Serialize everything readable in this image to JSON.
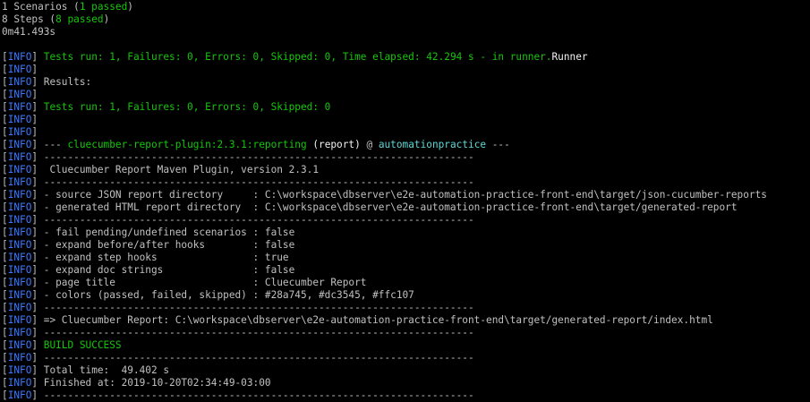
{
  "colors": {
    "background": "#000000",
    "text": "#c0c0c0",
    "success_green": "#16c60c",
    "info_blue": "#3b78ff",
    "artifact_cyan": "#61d6d6",
    "bright_white": "#f2f2f2"
  },
  "lines": [
    [
      {
        "t": "1 Scenarios (",
        "c": "w"
      },
      {
        "t": "1 passed",
        "c": "g"
      },
      {
        "t": ")",
        "c": "w"
      }
    ],
    [
      {
        "t": "8 Steps (",
        "c": "w"
      },
      {
        "t": "8 passed",
        "c": "g"
      },
      {
        "t": ")",
        "c": "w"
      }
    ],
    [
      {
        "t": "0m41.493s",
        "c": "w"
      }
    ],
    [],
    [
      {
        "t": "[",
        "c": "w"
      },
      {
        "t": "INFO",
        "c": "b"
      },
      {
        "t": "] ",
        "c": "w"
      },
      {
        "t": "Tests run: 1, Failures: 0, Errors: 0, Skipped: 0, Time elapsed: 42.294 s - in runner.",
        "c": "g"
      },
      {
        "t": "Runner",
        "c": "bw"
      }
    ],
    [
      {
        "t": "[",
        "c": "w"
      },
      {
        "t": "INFO",
        "c": "b"
      },
      {
        "t": "] ",
        "c": "w"
      }
    ],
    [
      {
        "t": "[",
        "c": "w"
      },
      {
        "t": "INFO",
        "c": "b"
      },
      {
        "t": "] Results:",
        "c": "w"
      }
    ],
    [
      {
        "t": "[",
        "c": "w"
      },
      {
        "t": "INFO",
        "c": "b"
      },
      {
        "t": "] ",
        "c": "w"
      }
    ],
    [
      {
        "t": "[",
        "c": "w"
      },
      {
        "t": "INFO",
        "c": "b"
      },
      {
        "t": "] ",
        "c": "w"
      },
      {
        "t": "Tests run: 1, Failures: 0, Errors: 0, Skipped: 0",
        "c": "g"
      }
    ],
    [
      {
        "t": "[",
        "c": "w"
      },
      {
        "t": "INFO",
        "c": "b"
      },
      {
        "t": "] ",
        "c": "w"
      }
    ],
    [
      {
        "t": "[",
        "c": "w"
      },
      {
        "t": "INFO",
        "c": "b"
      },
      {
        "t": "] ",
        "c": "w"
      }
    ],
    [
      {
        "t": "[",
        "c": "w"
      },
      {
        "t": "INFO",
        "c": "b"
      },
      {
        "t": "] ",
        "c": "w"
      },
      {
        "t": "--- ",
        "c": "w"
      },
      {
        "t": "cluecumber-report-plugin:2.3.1:reporting",
        "c": "g"
      },
      {
        "t": " (report)",
        "c": "bw"
      },
      {
        "t": " @ ",
        "c": "w"
      },
      {
        "t": "automationpractice",
        "c": "c"
      },
      {
        "t": " ---",
        "c": "w"
      }
    ],
    [
      {
        "t": "[",
        "c": "w"
      },
      {
        "t": "INFO",
        "c": "b"
      },
      {
        "t": "] ------------------------------------------------------------------------",
        "c": "w"
      }
    ],
    [
      {
        "t": "[",
        "c": "w"
      },
      {
        "t": "INFO",
        "c": "b"
      },
      {
        "t": "]  Cluecumber Report Maven Plugin, version 2.3.1",
        "c": "w"
      }
    ],
    [
      {
        "t": "[",
        "c": "w"
      },
      {
        "t": "INFO",
        "c": "b"
      },
      {
        "t": "] ------------------------------------------------------------------------",
        "c": "w"
      }
    ],
    [
      {
        "t": "[",
        "c": "w"
      },
      {
        "t": "INFO",
        "c": "b"
      },
      {
        "t": "] - source JSON report directory     : C:\\workspace\\dbserver\\e2e-automation-practice-front-end\\target/json-cucumber-reports",
        "c": "w"
      }
    ],
    [
      {
        "t": "[",
        "c": "w"
      },
      {
        "t": "INFO",
        "c": "b"
      },
      {
        "t": "] - generated HTML report directory  : C:\\workspace\\dbserver\\e2e-automation-practice-front-end\\target/generated-report",
        "c": "w"
      }
    ],
    [
      {
        "t": "[",
        "c": "w"
      },
      {
        "t": "INFO",
        "c": "b"
      },
      {
        "t": "] ------------------------------------------------------------------------",
        "c": "w"
      }
    ],
    [
      {
        "t": "[",
        "c": "w"
      },
      {
        "t": "INFO",
        "c": "b"
      },
      {
        "t": "] - fail pending/undefined scenarios : false",
        "c": "w"
      }
    ],
    [
      {
        "t": "[",
        "c": "w"
      },
      {
        "t": "INFO",
        "c": "b"
      },
      {
        "t": "] - expand before/after hooks        : false",
        "c": "w"
      }
    ],
    [
      {
        "t": "[",
        "c": "w"
      },
      {
        "t": "INFO",
        "c": "b"
      },
      {
        "t": "] - expand step hooks                : true",
        "c": "w"
      }
    ],
    [
      {
        "t": "[",
        "c": "w"
      },
      {
        "t": "INFO",
        "c": "b"
      },
      {
        "t": "] - expand doc strings               : false",
        "c": "w"
      }
    ],
    [
      {
        "t": "[",
        "c": "w"
      },
      {
        "t": "INFO",
        "c": "b"
      },
      {
        "t": "] - page title                       : Cluecumber Report",
        "c": "w"
      }
    ],
    [
      {
        "t": "[",
        "c": "w"
      },
      {
        "t": "INFO",
        "c": "b"
      },
      {
        "t": "] - colors (passed, failed, skipped) : #28a745, #dc3545, #ffc107",
        "c": "w"
      }
    ],
    [
      {
        "t": "[",
        "c": "w"
      },
      {
        "t": "INFO",
        "c": "b"
      },
      {
        "t": "] ------------------------------------------------------------------------",
        "c": "w"
      }
    ],
    [
      {
        "t": "[",
        "c": "w"
      },
      {
        "t": "INFO",
        "c": "b"
      },
      {
        "t": "] => Cluecumber Report: C:\\workspace\\dbserver\\e2e-automation-practice-front-end\\target/generated-report/index.html",
        "c": "w"
      }
    ],
    [
      {
        "t": "[",
        "c": "w"
      },
      {
        "t": "INFO",
        "c": "b"
      },
      {
        "t": "] ------------------------------------------------------------------------",
        "c": "w"
      }
    ],
    [
      {
        "t": "[",
        "c": "w"
      },
      {
        "t": "INFO",
        "c": "b"
      },
      {
        "t": "] ",
        "c": "w"
      },
      {
        "t": "BUILD SUCCESS",
        "c": "g"
      }
    ],
    [
      {
        "t": "[",
        "c": "w"
      },
      {
        "t": "INFO",
        "c": "b"
      },
      {
        "t": "] ------------------------------------------------------------------------",
        "c": "w"
      }
    ],
    [
      {
        "t": "[",
        "c": "w"
      },
      {
        "t": "INFO",
        "c": "b"
      },
      {
        "t": "] Total time:  49.402 s",
        "c": "w"
      }
    ],
    [
      {
        "t": "[",
        "c": "w"
      },
      {
        "t": "INFO",
        "c": "b"
      },
      {
        "t": "] Finished at: 2019-10-20T02:34:49-03:00",
        "c": "w"
      }
    ],
    [
      {
        "t": "[",
        "c": "w"
      },
      {
        "t": "INFO",
        "c": "b"
      },
      {
        "t": "] ------------------------------------------------------------------------",
        "c": "w"
      }
    ]
  ]
}
